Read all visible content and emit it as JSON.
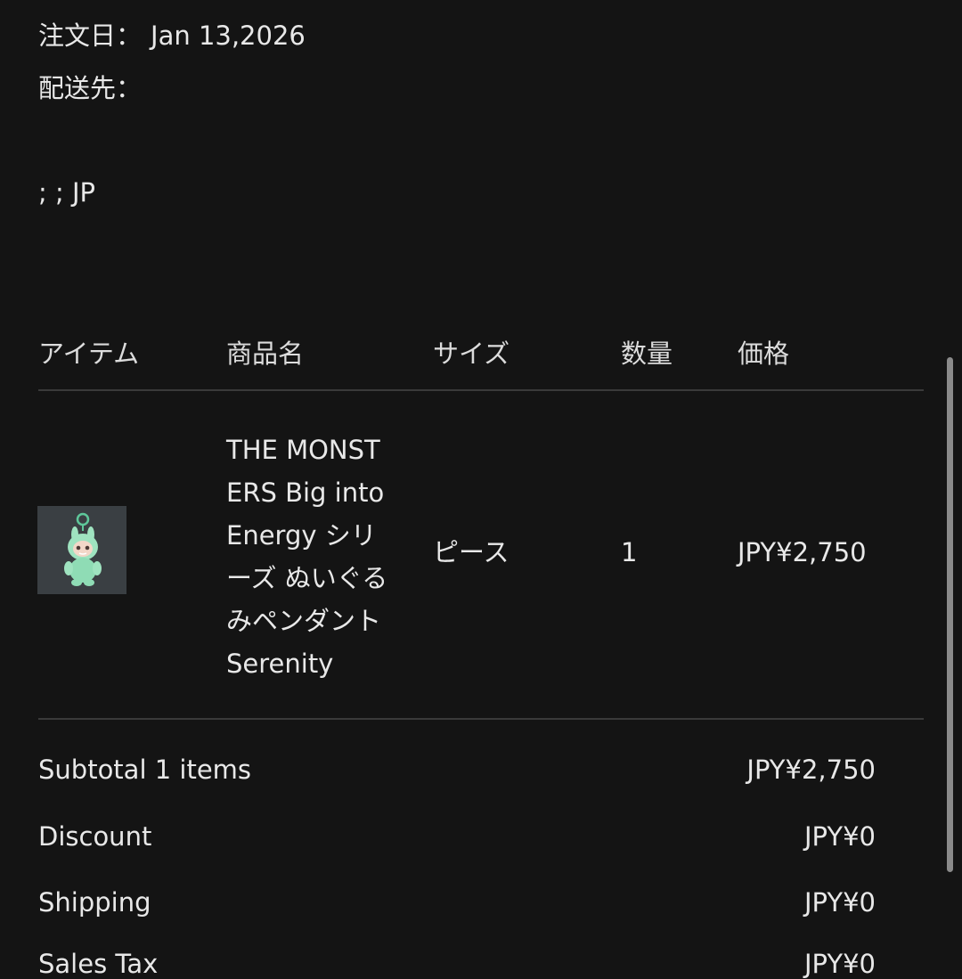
{
  "order": {
    "date_label": "注文日：",
    "date_value": "Jan 13,2026",
    "shipping_label": "配送先：",
    "address": "; ; JP"
  },
  "table": {
    "headers": [
      "アイテム",
      "商品名",
      "サイズ",
      "数量",
      "価格"
    ],
    "rows": [
      {
        "image_icon": "plush-pendant-thumbnail",
        "name": "THE MONST\nERS Big into\nEnergy シリ\nーズ ぬいぐる\nみペンダント\nSerenity",
        "size": "ピース",
        "quantity": "1",
        "price": "JPY¥2,750"
      }
    ]
  },
  "summary": {
    "subtotal_label": "Subtotal 1 items",
    "subtotal_value": "JPY¥2,750",
    "discount_label": "Discount",
    "discount_value": "JPY¥0",
    "shipping_label": "Shipping",
    "shipping_value": "JPY¥0",
    "tax_label": "Sales Tax",
    "tax_value": "JPY¥0"
  },
  "colors": {
    "background": "#141414",
    "text": "#e8e8e8",
    "divider": "#3a3a3a",
    "thumbnail_bg": "#3a3f43",
    "plush": "#9fe3c0"
  }
}
